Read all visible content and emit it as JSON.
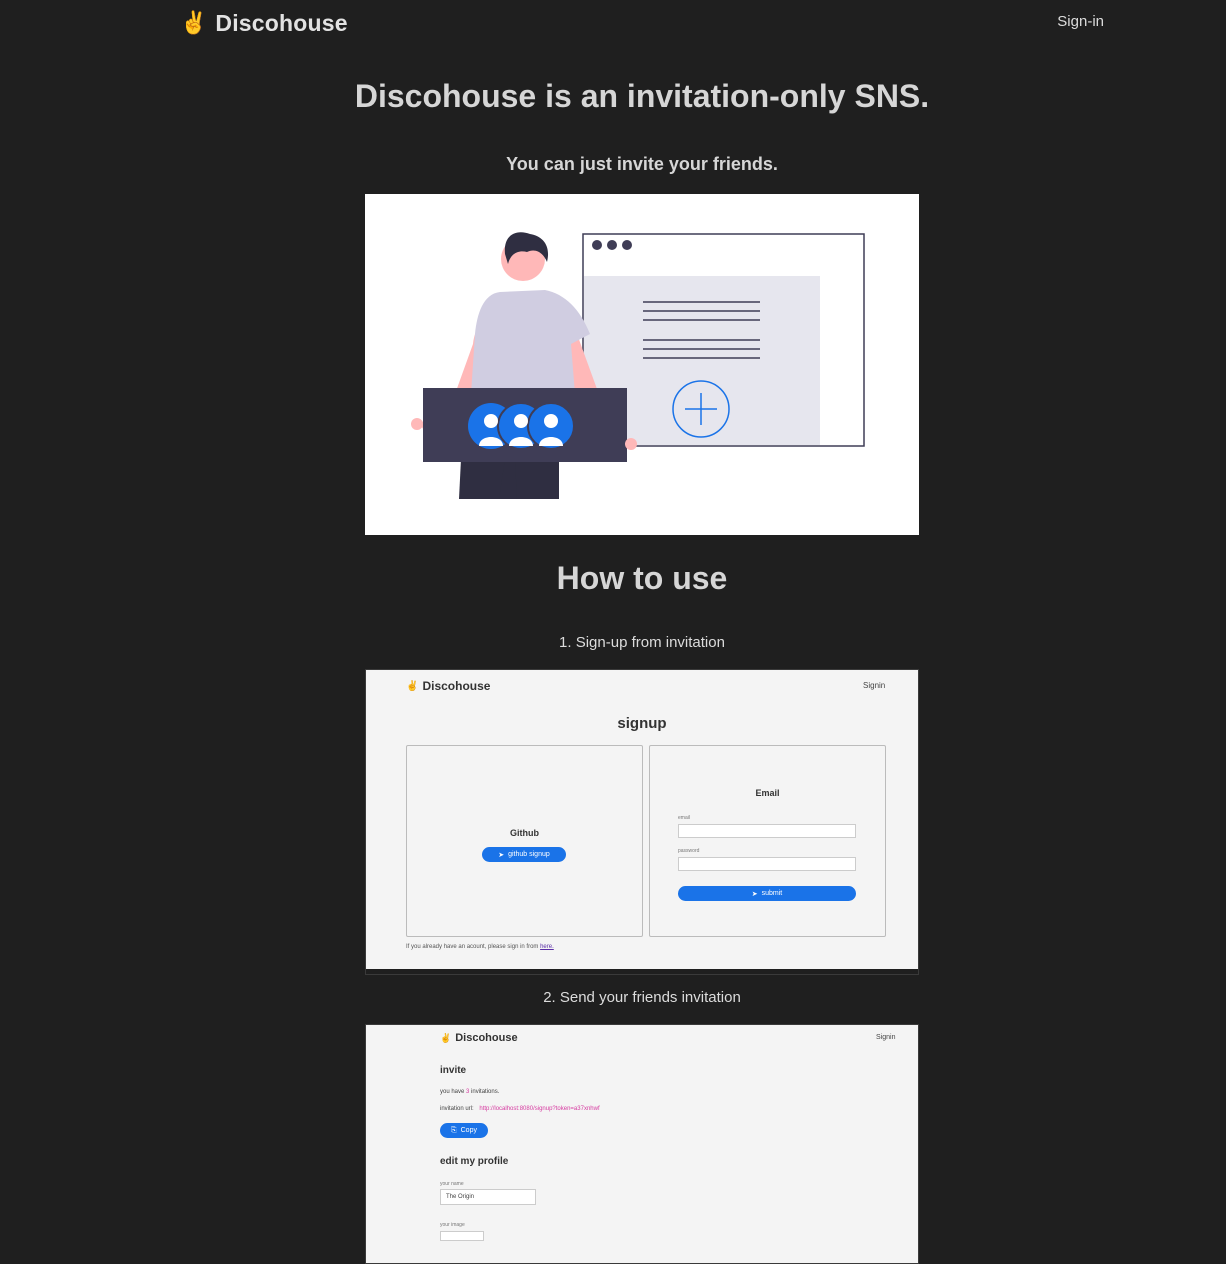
{
  "header": {
    "brand_emoji": "✌️",
    "brand_name": "Discohouse",
    "signin_label": "Sign-in"
  },
  "hero": {
    "title": "Discohouse is an invitation-only SNS.",
    "subtitle": "You can just invite your friends."
  },
  "howto": {
    "title": "How to use",
    "steps": [
      {
        "label": "1. Sign-up from invitation",
        "screenshot": {
          "brand": "Discohouse",
          "signin": "Signin",
          "page_title": "signup",
          "github_card": {
            "title": "Github",
            "button": "github signup"
          },
          "email_card": {
            "title": "Email",
            "email_label": "email",
            "password_label": "password",
            "submit": "submit"
          },
          "footer_text": "If you already have an acount, please sign in from",
          "footer_link": "here."
        }
      },
      {
        "label": "2. Send your friends invitation",
        "screenshot": {
          "brand": "Discohouse",
          "signin": "Signin",
          "invite_heading": "invite",
          "invitations_prefix": "you have",
          "invitations_count": "3",
          "invitations_suffix": "invitations.",
          "invitation_url_label": "invitation url:",
          "invitation_url": "http://localhost:8080/signup?token=a37xnhwf",
          "copy_button": "Copy",
          "profile_heading": "edit my profile",
          "name_label": "your name",
          "name_value": "The Origin",
          "image_label": "your image"
        }
      }
    ]
  },
  "colors": {
    "background": "#1f1f1f",
    "accent_blue": "#1a73e8",
    "pink_link": "#d63aa0",
    "illustration_dark": "#3f3d56"
  }
}
